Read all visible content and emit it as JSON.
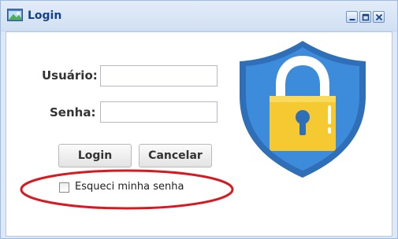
{
  "window": {
    "title": "Login",
    "icon": "app-window-icon",
    "controls": [
      "minimize-icon",
      "maximize-icon",
      "close-icon"
    ]
  },
  "form": {
    "user_label": "Usuário:",
    "user_value": "",
    "password_label": "Senha:",
    "password_value": ""
  },
  "buttons": {
    "login": "Login",
    "cancel": "Cancelar"
  },
  "forgot": {
    "label": "Esqueci minha senha",
    "checked": false
  },
  "illustration": {
    "icon": "security-shield-lock-icon"
  },
  "colors": {
    "title": "#15428b",
    "shield": "#2a74c4",
    "lock": "#f4c430",
    "highlight": "#d71920"
  }
}
